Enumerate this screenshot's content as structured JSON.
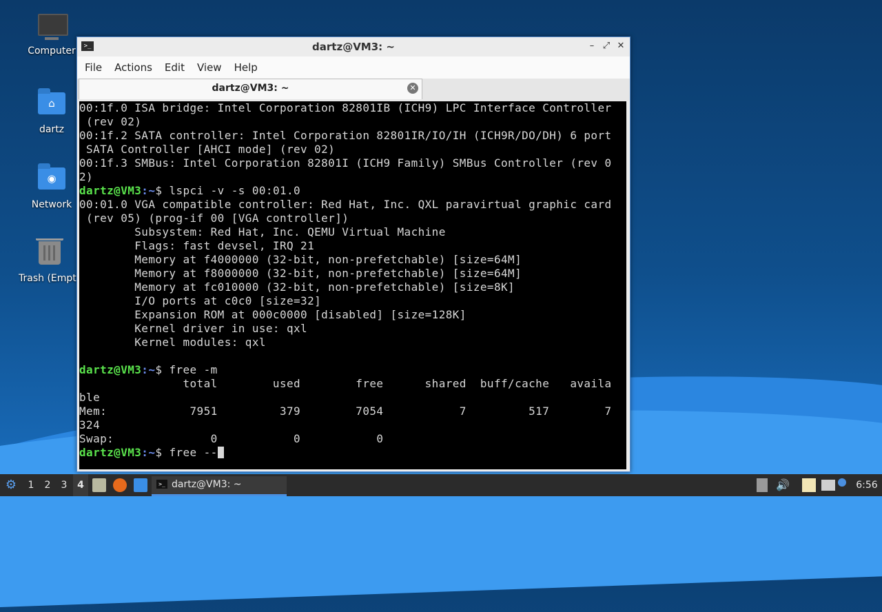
{
  "desktop": {
    "icons": [
      {
        "label": "Computer"
      },
      {
        "label": "dartz"
      },
      {
        "label": "Network"
      },
      {
        "label": "Trash (Empty)"
      }
    ]
  },
  "window": {
    "title": "dartz@VM3: ~",
    "controls": {
      "minimize": "–",
      "maximize": "⤢",
      "close": "✕"
    },
    "menu": [
      "File",
      "Actions",
      "Edit",
      "View",
      "Help"
    ],
    "tab_label": "dartz@VM3: ~",
    "tab_close": "✕"
  },
  "terminal": {
    "prompt_user": "dartz@VM3",
    "prompt_path": ":~",
    "prompt_symbol": "$",
    "lines": [
      {
        "text": "00:1f.0 ISA bridge: Intel Corporation 82801IB (ICH9) LPC Interface Controller"
      },
      {
        "text": " (rev 02)"
      },
      {
        "text": "00:1f.2 SATA controller: Intel Corporation 82801IR/IO/IH (ICH9R/DO/DH) 6 port"
      },
      {
        "text": " SATA Controller [AHCI mode] (rev 02)"
      },
      {
        "text": "00:1f.3 SMBus: Intel Corporation 82801I (ICH9 Family) SMBus Controller (rev 0"
      },
      {
        "text": "2)"
      },
      {
        "prompt": true,
        "text": " lspci -v -s 00:01.0"
      },
      {
        "text": "00:01.0 VGA compatible controller: Red Hat, Inc. QXL paravirtual graphic card"
      },
      {
        "text": " (rev 05) (prog-if 00 [VGA controller])"
      },
      {
        "text": "        Subsystem: Red Hat, Inc. QEMU Virtual Machine"
      },
      {
        "text": "        Flags: fast devsel, IRQ 21"
      },
      {
        "text": "        Memory at f4000000 (32-bit, non-prefetchable) [size=64M]"
      },
      {
        "text": "        Memory at f8000000 (32-bit, non-prefetchable) [size=64M]"
      },
      {
        "text": "        Memory at fc010000 (32-bit, non-prefetchable) [size=8K]"
      },
      {
        "text": "        I/O ports at c0c0 [size=32]"
      },
      {
        "text": "        Expansion ROM at 000c0000 [disabled] [size=128K]"
      },
      {
        "text": "        Kernel driver in use: qxl"
      },
      {
        "text": "        Kernel modules: qxl"
      },
      {
        "text": ""
      },
      {
        "prompt": true,
        "text": " free -m"
      },
      {
        "text": "               total        used        free      shared  buff/cache   availa"
      },
      {
        "text": "ble"
      },
      {
        "text": "Mem:            7951         379        7054           7         517        7"
      },
      {
        "text": "324"
      },
      {
        "text": "Swap:              0           0           0"
      },
      {
        "prompt": true,
        "text": " free --",
        "cursor": true
      }
    ]
  },
  "taskbar": {
    "workspaces": [
      "1",
      "2",
      "3",
      "4"
    ],
    "active_workspace": "4",
    "task_label": "dartz@VM3: ~",
    "clock": "6:56"
  }
}
